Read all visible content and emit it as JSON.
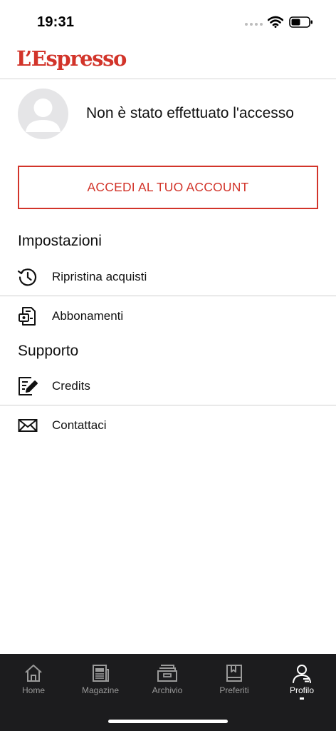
{
  "status_bar": {
    "time": "19:31"
  },
  "header": {
    "logo": "L’Espresso"
  },
  "profile": {
    "status": "Non è stato effettuato l'accesso"
  },
  "login_button": {
    "label": "ACCEDI AL TUO ACCOUNT"
  },
  "settings": {
    "title": "Impostazioni",
    "items": [
      {
        "label": "Ripristina acquisti",
        "icon": "history-icon"
      },
      {
        "label": "Abbonamenti",
        "icon": "subscription-icon"
      }
    ]
  },
  "support": {
    "title": "Supporto",
    "items": [
      {
        "label": "Credits",
        "icon": "document-edit-icon"
      },
      {
        "label": "Contattaci",
        "icon": "envelope-icon"
      }
    ]
  },
  "tab_bar": {
    "active": "Profilo",
    "tabs": [
      {
        "label": "Home",
        "icon": "home-icon"
      },
      {
        "label": "Magazine",
        "icon": "newspaper-icon"
      },
      {
        "label": "Archivio",
        "icon": "archive-icon"
      },
      {
        "label": "Preferiti",
        "icon": "bookmark-icon"
      },
      {
        "label": "Profilo",
        "icon": "user-icon"
      }
    ]
  },
  "colors": {
    "brand": "#d2342a",
    "tab_bar_bg": "#1c1c1e",
    "avatar_bg": "#e5e5e7"
  }
}
